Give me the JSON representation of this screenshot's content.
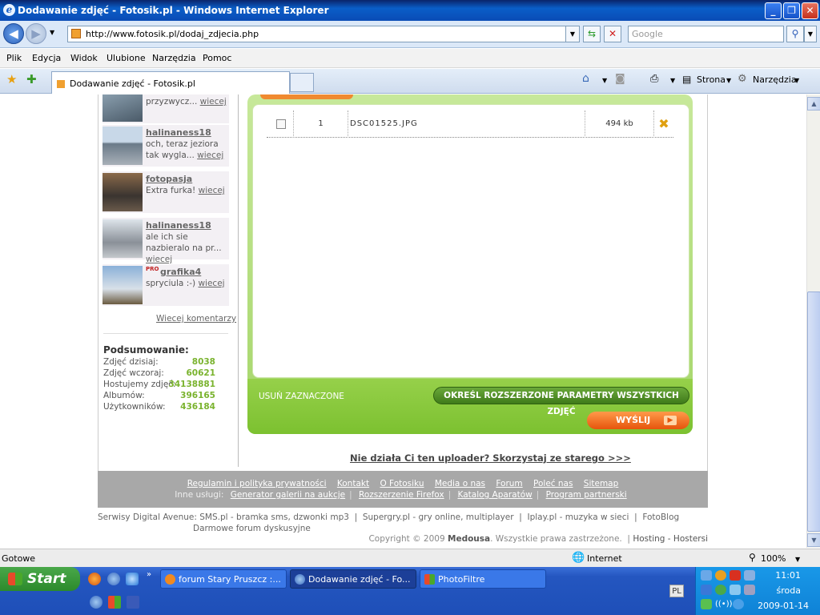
{
  "window": {
    "title": "Dodawanie zdjęć - Fotosik.pl - Windows Internet Explorer"
  },
  "address": {
    "url": "http://www.fotosik.pl/dodaj_zdjecia.php",
    "search_placeholder": "Google"
  },
  "menu": [
    "Plik",
    "Edycja",
    "Widok",
    "Ulubione",
    "Narzędzia",
    "Pomoc"
  ],
  "tab": {
    "title": "Dodawanie zdjęć - Fotosik.pl"
  },
  "toolbar": {
    "strona": "Strona",
    "narzedzia": "Narzędzia"
  },
  "comments": [
    {
      "user": "",
      "text": "to prawda, tak sie przyzwycz...",
      "more": "wiecej"
    },
    {
      "user": "halinaness18",
      "text": "och, teraz jeziora tak wygla...",
      "more": "wiecej"
    },
    {
      "user": "fotopasja",
      "text": "Extra furka!",
      "more": "wiecej"
    },
    {
      "user": "halinaness18",
      "text": "ale ich sie nazbieralo na pr...",
      "more": "wiecej"
    },
    {
      "user": "grafika4",
      "text": "spryciula :-)",
      "more": "wiecej",
      "badge": "PRO"
    }
  ],
  "more_comments": "Wiecej komentarzy",
  "summary": {
    "title": "Podsumowanie:",
    "rows": [
      {
        "label": "Zdjęć dzisiaj:",
        "value": "8038"
      },
      {
        "label": "Zdjęć wczoraj:",
        "value": "60621"
      },
      {
        "label": "Hostujemy zdjęć:",
        "value": "34138881"
      },
      {
        "label": "Albumów:",
        "value": "396165"
      },
      {
        "label": "Użytkowników:",
        "value": "436184"
      }
    ]
  },
  "file": {
    "index": "1",
    "name": "DSC01525.JPG",
    "size": "494 kb"
  },
  "buttons": {
    "remove_selected": "USUŃ ZAZNACZONE",
    "advanced": "OKREŚL ROZSZERZONE PARAMETRY WSZYSTKICH ZDJĘĆ",
    "send": "WYŚLIJ"
  },
  "old_uploader": "Nie działa Ci ten uploader? Skorzystaj ze starego >>>",
  "footer": {
    "links1": [
      "Regulamin i polityka prywatności",
      "Kontakt",
      "O Fotosiku",
      "Media o nas",
      "Forum",
      "Poleć nas",
      "Sitemap"
    ],
    "other_label": "Inne usługi:",
    "links2": [
      "Generator galerii na aukcje",
      "Rozszerzenie Firefox",
      "Katalog Aparatów",
      "Program partnerski"
    ]
  },
  "partners": {
    "label": "Serwisy Digital Avenue:",
    "items": [
      "SMS.pl - bramka sms, dzwonki mp3",
      "Supergry.pl - gry online, multiplayer",
      "Iplay.pl - muzyka w sieci",
      "FotoBlog",
      "Darmowe forum dyskusyjne"
    ]
  },
  "copyright": {
    "pre": "Copyright © 2009",
    "brand": "Medousa",
    "post": ". Wszystkie prawa zastrzeżone.",
    "links": "Hosting - Hostersi"
  },
  "status": {
    "text": "Gotowe",
    "zone": "Internet",
    "zoom": "100%"
  },
  "taskbar": {
    "start": "Start",
    "tasks": [
      "forum Stary Pruszcz :...",
      "Dodawanie zdjęć - Fo...",
      "PhotoFiltre"
    ],
    "lang": "PL",
    "time": "11:01",
    "day": "środa",
    "date": "2009-01-14"
  },
  "colors": {
    "accent_green": "#7cc130",
    "send_orange": "#e6540c",
    "stat_green": "#7ab32e"
  }
}
